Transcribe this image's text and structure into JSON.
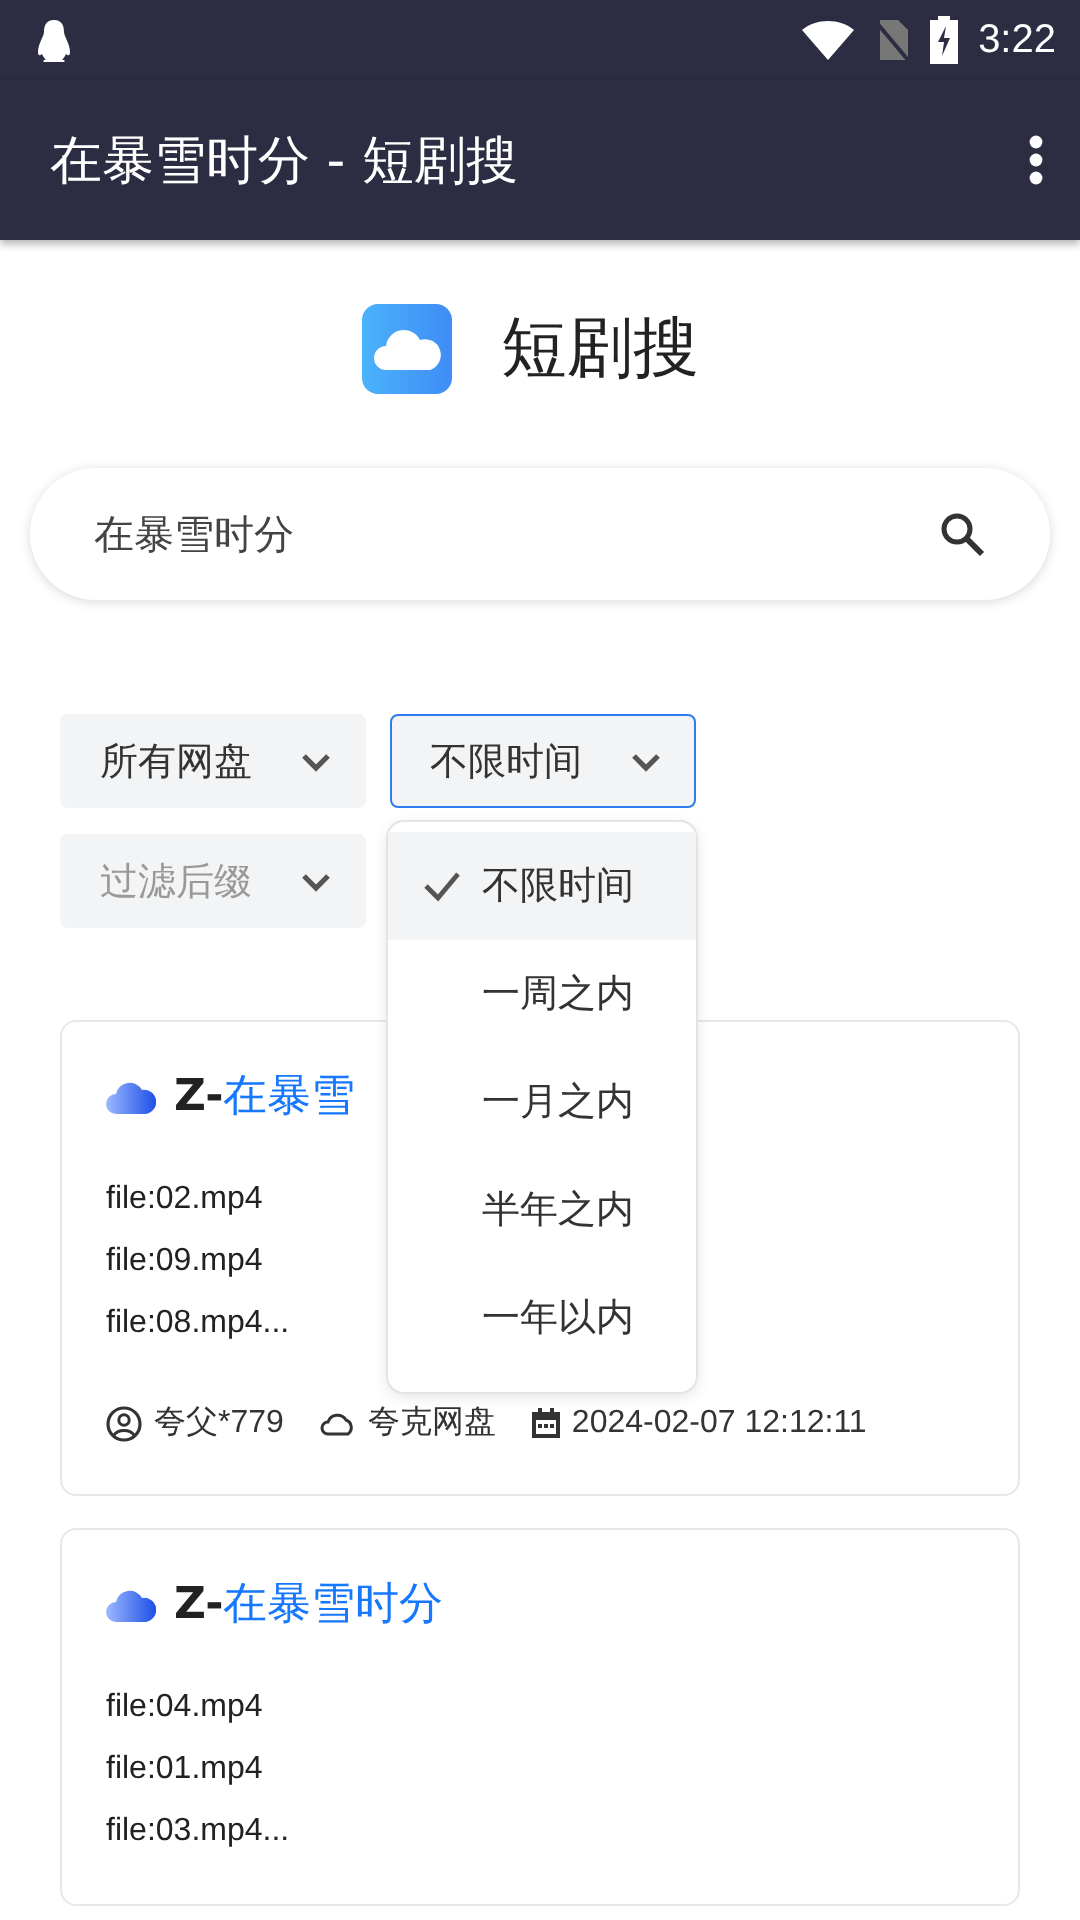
{
  "status_bar": {
    "time": "3:22"
  },
  "app_bar": {
    "title": "在暴雪时分 - 短剧搜"
  },
  "header": {
    "title": "短剧搜"
  },
  "search": {
    "value": "在暴雪时分"
  },
  "filters": [
    {
      "value": "所有网盘",
      "open": false
    },
    {
      "value": "不限时间",
      "open": true,
      "options": [
        {
          "label": "不限时间",
          "selected": true
        },
        {
          "label": "一周之内",
          "selected": false
        },
        {
          "label": "一月之内",
          "selected": false
        },
        {
          "label": "半年之内",
          "selected": false
        },
        {
          "label": "一年以内",
          "selected": false
        }
      ]
    },
    {
      "placeholder": "过滤后缀",
      "open": false
    }
  ],
  "results": [
    {
      "prefix": "Z-",
      "name": "在暴雪",
      "files": [
        "file:02.mp4",
        "file:09.mp4",
        "file:08.mp4..."
      ],
      "user": "夸父*779",
      "disk": "夸克网盘",
      "date": "2024-02-07 12:12:11"
    },
    {
      "prefix": "Z-",
      "name": "在暴雪时分",
      "files": [
        "file:04.mp4",
        "file:01.mp4",
        "file:03.mp4..."
      ]
    }
  ]
}
